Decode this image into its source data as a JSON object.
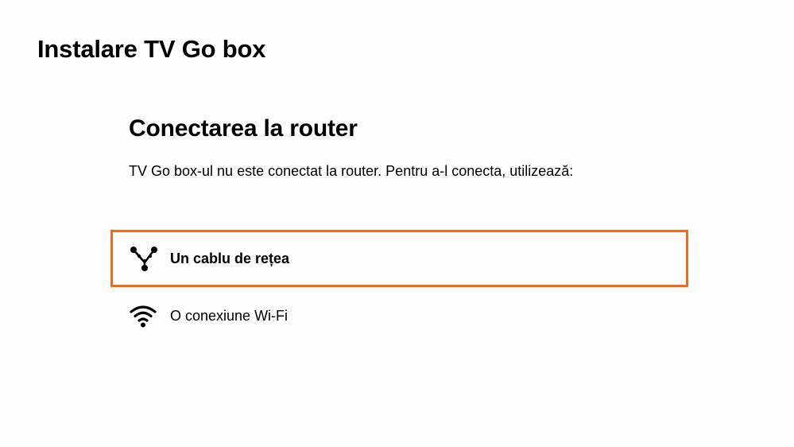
{
  "page": {
    "title": "Instalare TV Go box"
  },
  "section": {
    "title": "Conectarea la router",
    "description": "TV Go box-ul nu este conectat la router. Pentru a-l conecta, utilizează:"
  },
  "options": [
    {
      "label": "Un cablu de rețea",
      "icon": "network-cable-icon",
      "selected": true
    },
    {
      "label": "O conexiune Wi-Fi",
      "icon": "wifi-icon",
      "selected": false
    }
  ],
  "colors": {
    "accent": "#f26b1d",
    "text": "#000000",
    "background": "#fdfdfd"
  }
}
